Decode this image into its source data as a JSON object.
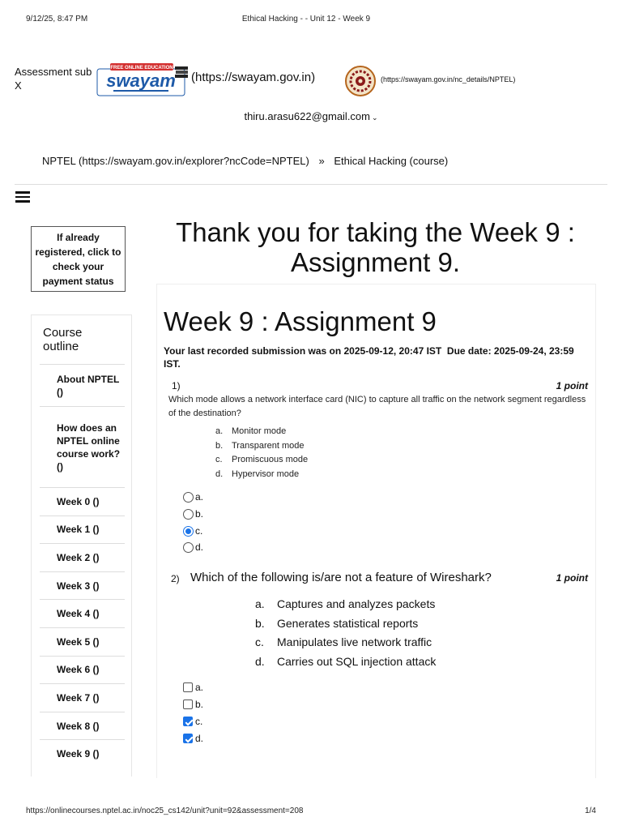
{
  "print_header": {
    "date": "9/12/25, 8:47 PM",
    "doc_title": "Ethical Hacking - - Unit 12 - Week 9"
  },
  "header": {
    "tab_label": "Assessment sub X",
    "swayam_logo_text": "swayam",
    "swayam_banner_text": "FREE ONLINE EDUCATION",
    "swayam_url": "(https://swayam.gov.in)",
    "nptel_url": "(https://swayam.gov.in/nc_details/NPTEL)",
    "account_email": "thiru.arasu622@gmail.com",
    "account_chevron": "⌄"
  },
  "breadcrumb": {
    "items": [
      "NPTEL (https://swayam.gov.in/explorer?ncCode=NPTEL)",
      "Ethical Hacking (course)"
    ],
    "separator": "»"
  },
  "icons": {
    "menu": "hamburger-menu-icon",
    "account": "chevron-down-icon",
    "swayam": "swayam-logo",
    "nptel": "nptel-logo"
  },
  "sidebar": {
    "payment_status": "If already registered, click to check your payment status",
    "outline_heading": "Course outline",
    "items": [
      {
        "label": "About NPTEL ()"
      },
      {
        "label": "How does an NPTEL online course work? ()"
      },
      {
        "label": "Week 0 ()"
      },
      {
        "label": "Week 1 ()"
      },
      {
        "label": "Week 2 ()"
      },
      {
        "label": "Week 3 ()"
      },
      {
        "label": "Week 4 ()"
      },
      {
        "label": "Week 5 ()"
      },
      {
        "label": "Week 6 ()"
      },
      {
        "label": "Week 7 ()"
      },
      {
        "label": "Week 8 ()"
      },
      {
        "label": "Week 9 ()"
      }
    ]
  },
  "main": {
    "thank_you": "Thank you for taking the Week 9 : Assignment 9.",
    "assignment_title": "Week 9 : Assignment 9",
    "submission_info": "Your last recorded submission was on 2025-09-12, 20:47 IST",
    "due_date": "Due date: 2025-09-24, 23:59 IST.",
    "questions": [
      {
        "number": "1)",
        "points": "1 point",
        "text": "Which mode allows a network interface card (NIC) to capture all traffic on the network segment regardless of the destination?",
        "options": [
          {
            "letter": "a.",
            "text": "Monitor mode"
          },
          {
            "letter": "b.",
            "text": "Transparent mode"
          },
          {
            "letter": "c.",
            "text": "Promiscuous mode"
          },
          {
            "letter": "d.",
            "text": "Hypervisor mode"
          }
        ],
        "answers": [
          {
            "label": "a.",
            "selected": false
          },
          {
            "label": "b.",
            "selected": false
          },
          {
            "label": "c.",
            "selected": true
          },
          {
            "label": "d.",
            "selected": false
          }
        ]
      },
      {
        "number": "2)",
        "points": "1 point",
        "text": "Which of the following is/are not a feature of Wireshark?",
        "options": [
          {
            "letter": "a.",
            "text": "Captures and analyzes packets"
          },
          {
            "letter": "b.",
            "text": "Generates statistical reports"
          },
          {
            "letter": "c.",
            "text": "Manipulates live network traffic"
          },
          {
            "letter": "d.",
            "text": "Carries out SQL injection attack"
          }
        ],
        "answers": [
          {
            "label": "a.",
            "selected": false
          },
          {
            "label": "b.",
            "selected": false
          },
          {
            "label": "c.",
            "selected": true
          },
          {
            "label": "d.",
            "selected": true
          }
        ]
      }
    ]
  },
  "print_footer": {
    "url": "https://onlinecourses.nptel.ac.in/noc25_cs142/unit?unit=92&assessment=208",
    "page": "1/4"
  },
  "colors": {
    "accent": "#1a73e8",
    "swayam_blue": "#1e5aa8",
    "swayam_red": "#d32f2f"
  }
}
